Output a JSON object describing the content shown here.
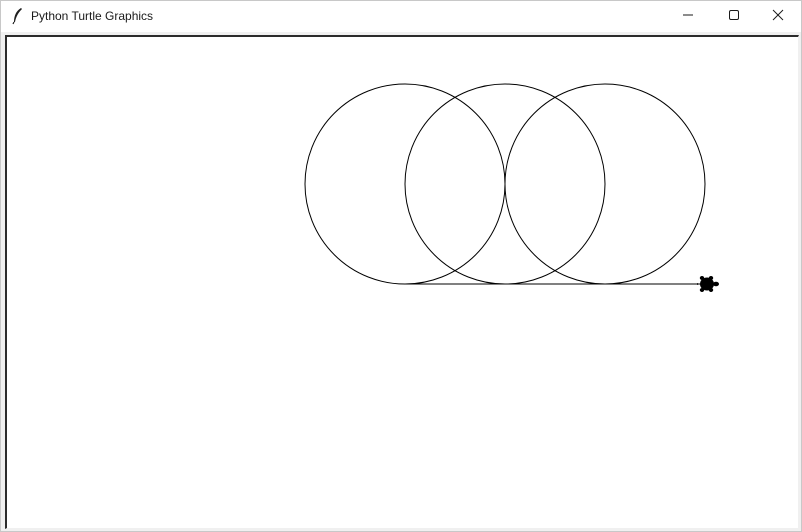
{
  "window": {
    "title": "Python Turtle Graphics",
    "icon": "feather-icon",
    "controls": [
      "minimize-icon",
      "maximize-icon",
      "close-icon"
    ]
  },
  "canvas": {
    "background": "#ffffff",
    "pen_color": "#000000",
    "drawing": {
      "shapes": [
        "circle",
        "circle",
        "circle",
        "line"
      ],
      "turtle_icon": "turtle-icon"
    }
  }
}
